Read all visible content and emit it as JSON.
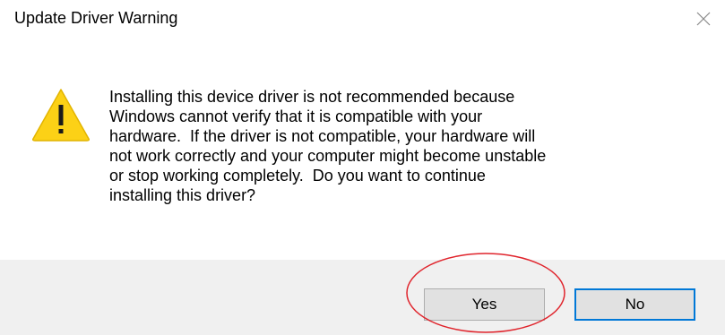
{
  "dialog": {
    "title": "Update Driver Warning",
    "close_icon": "close-icon",
    "warning_icon": "warning-triangle-icon",
    "message_lines": [
      "Installing this device driver is not recommended because",
      "Windows cannot verify that it is compatible with your",
      "hardware.  If the driver is not compatible, your hardware will",
      "not work correctly and your computer might become unstable",
      "or stop working completely.  Do you want to continue",
      "installing this driver?"
    ],
    "buttons": {
      "yes_label": "Yes",
      "no_label": "No"
    }
  },
  "colors": {
    "footer_bg": "#f0f0f0",
    "button_bg": "#e1e1e1",
    "default_button_border": "#0078d7",
    "warning_fill": "#fcd116",
    "annotation": "#e0242c"
  }
}
